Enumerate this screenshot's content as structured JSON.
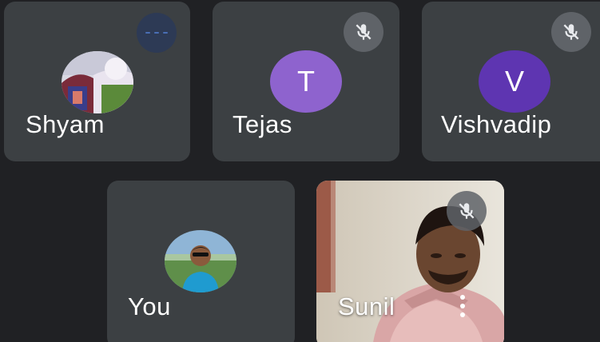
{
  "participants": [
    {
      "name": "Shyam",
      "status": "speaking",
      "avatar_type": "photo"
    },
    {
      "name": "Tejas",
      "status": "muted",
      "avatar_type": "letter",
      "avatar_letter": "T",
      "avatar_color": "#8e63ce"
    },
    {
      "name": "Vishvadip",
      "status": "muted",
      "avatar_type": "letter",
      "avatar_letter": "V",
      "avatar_color": "#5e35b1"
    },
    {
      "name": "You",
      "status": "unmuted",
      "avatar_type": "photo"
    },
    {
      "name": "Sunil",
      "status": "muted",
      "avatar_type": "video"
    }
  ],
  "colors": {
    "background": "#202124",
    "tile": "#3c4043",
    "mute_badge": "#5f6368",
    "text": "#ffffff"
  },
  "icons": {
    "mute": "mic-off-icon",
    "speaking": "audio-level-icon",
    "more": "more-vert-icon"
  }
}
